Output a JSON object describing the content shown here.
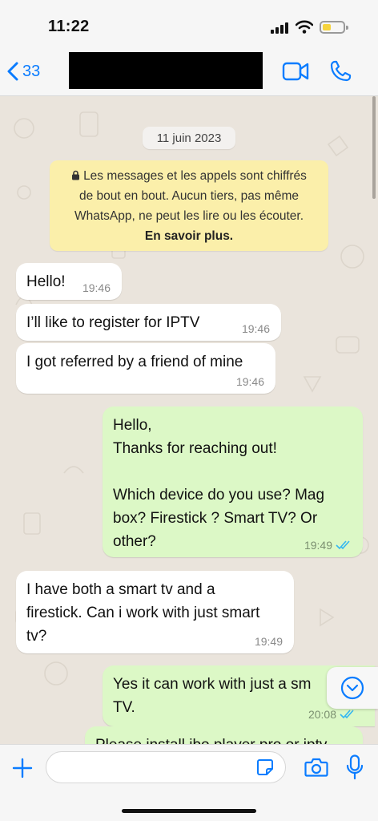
{
  "status_bar": {
    "time": "11:22"
  },
  "header": {
    "back_count": "33",
    "contact_name": ""
  },
  "chat": {
    "date": "11 juin 2023",
    "notice": {
      "line1": "Les messages et les appels sont chiffrés",
      "line2": "de bout en bout. Aucun tiers, pas même",
      "line3": "WhatsApp, ne peut les lire ou les écouter.",
      "link": "En savoir plus."
    },
    "messages": [
      {
        "direction": "in",
        "lines": [
          "Hello!"
        ],
        "time": "19:46"
      },
      {
        "direction": "in",
        "lines": [
          "I’ll like to register for IPTV"
        ],
        "time": "19:46"
      },
      {
        "direction": "in",
        "lines": [
          "I got referred by a friend of mine"
        ],
        "time": "19:46"
      },
      {
        "direction": "out",
        "lines": [
          "Hello,",
          "Thanks for reaching out!",
          "",
          "Which device do you use? Mag",
          "box? Firestick ? Smart TV? Or",
          "other?"
        ],
        "time": "19:49",
        "read": true
      },
      {
        "direction": "in",
        "lines": [
          "I have both a smart tv and a",
          "firestick. Can i work with just smart",
          "tv?"
        ],
        "time": "19:49"
      },
      {
        "direction": "out",
        "lines": [
          "Yes it can work with just a sm",
          "TV."
        ],
        "time": "20:08",
        "read": true
      },
      {
        "direction": "out",
        "lines": [
          "Please install ibo player pro or iptv"
        ],
        "time": ""
      }
    ]
  },
  "input": {
    "placeholder": ""
  },
  "icons": {
    "back": "chevron-left-icon",
    "video": "video-call-icon",
    "phone": "phone-icon",
    "lock": "lock-icon",
    "scroll_down": "chevron-down-circle-icon",
    "plus": "plus-icon",
    "sticker": "sticker-icon",
    "camera": "camera-icon",
    "mic": "microphone-icon"
  },
  "colors": {
    "accent": "#0a7cff",
    "incoming_bubble": "#ffffff",
    "outgoing_bubble": "#dcf8c6",
    "notice_bg": "#fbefaa",
    "chat_bg": "#eae4dc",
    "read_ticks": "#34b7f1"
  }
}
